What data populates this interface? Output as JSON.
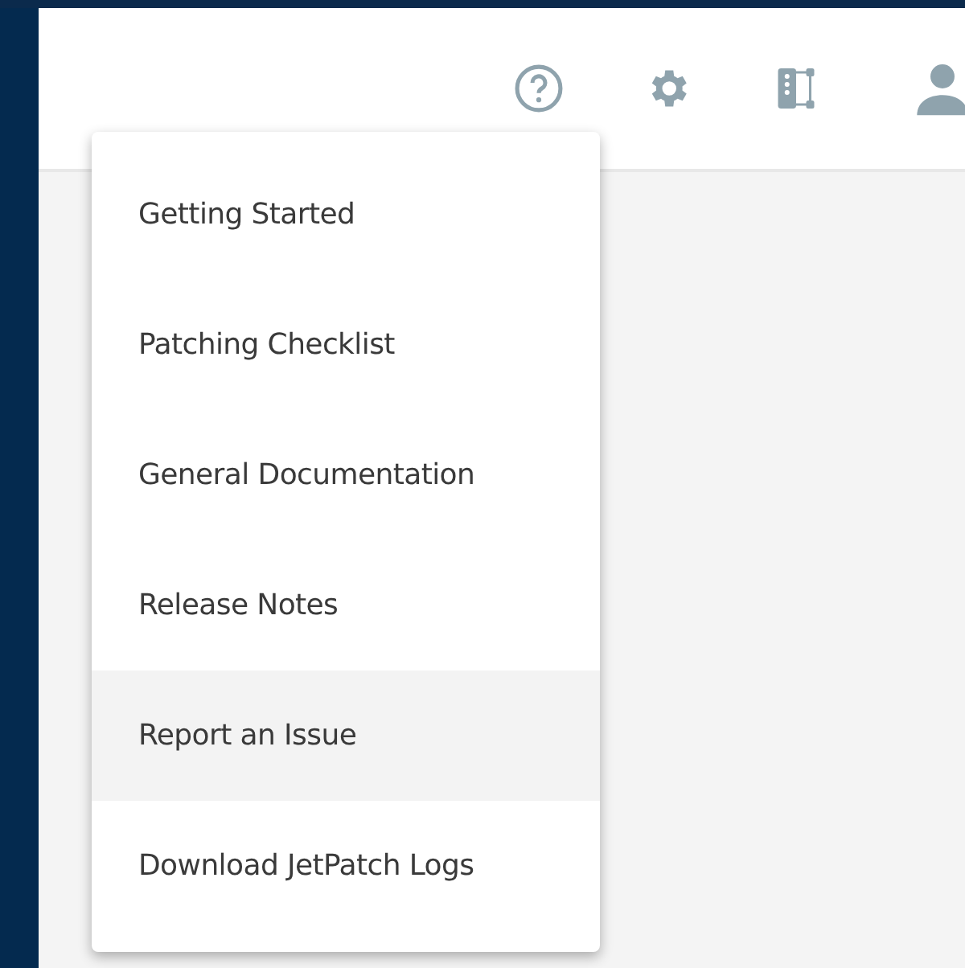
{
  "help_menu": {
    "items": [
      {
        "label": "Getting Started",
        "hovered": false
      },
      {
        "label": "Patching Checklist",
        "hovered": false
      },
      {
        "label": "General Documentation",
        "hovered": false
      },
      {
        "label": "Release Notes",
        "hovered": false
      },
      {
        "label": "Report an Issue",
        "hovered": true
      },
      {
        "label": "Download JetPatch Logs",
        "hovered": false
      }
    ]
  }
}
